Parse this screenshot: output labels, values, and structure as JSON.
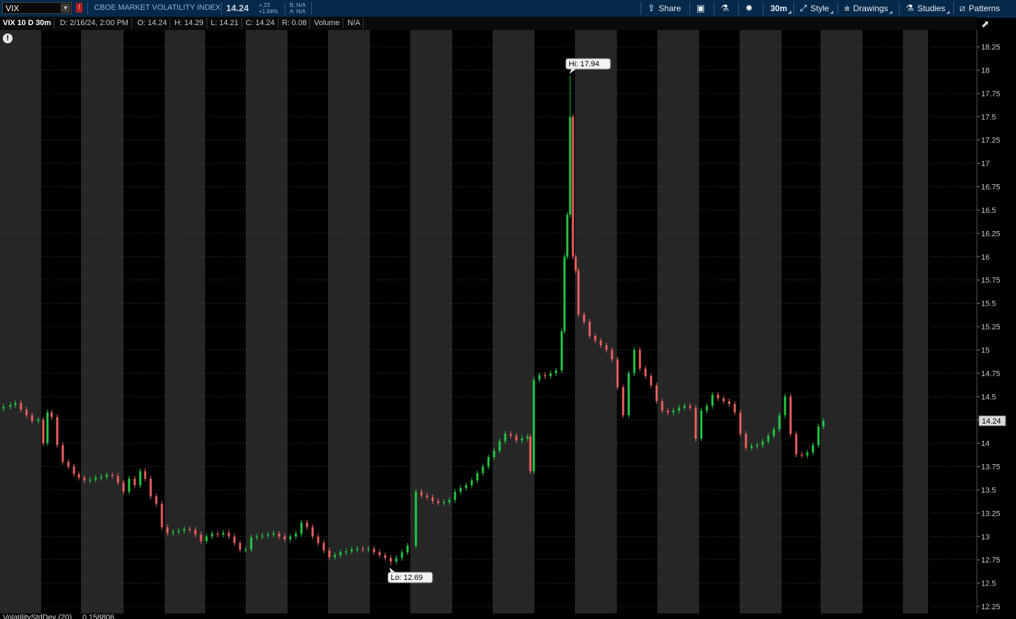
{
  "toolbar": {
    "symbol": "VIX",
    "flag": "!",
    "description": "CBOE MARKET VOLATILITY INDEX",
    "last": "14.24",
    "change": "+.23",
    "change_pct": "+1.64%",
    "bid": "B: N/A",
    "ask": "A: N/A",
    "share": "Share",
    "timeframe": "30m",
    "style": "Style",
    "drawings": "Drawings",
    "studies": "Studies",
    "patterns": "Patterns"
  },
  "infobar": {
    "symbol_period": "VIX 10 D 30m",
    "date": "D: 2/16/24, 2:00 PM",
    "open": "O: 14.24",
    "high": "H: 14.29",
    "low": "L: 14.21",
    "close": "C: 14.24",
    "range": "R: 0.08",
    "volume_label": "Volume",
    "volume_value": "N/A"
  },
  "study": {
    "label": "VolatilityStdDev (20)",
    "value": "0.158806"
  },
  "colors": {
    "up": "#22cc44",
    "down": "#f06060",
    "session_band": "#262626",
    "background": "#000000"
  },
  "chart_data": {
    "type": "candlestick",
    "symbol": "VIX",
    "interval": "30m",
    "y_ticks": [
      "12.25",
      "12.5",
      "12.75",
      "13",
      "13.25",
      "13.5",
      "13.75",
      "14",
      "14.25",
      "14.5",
      "14.75",
      "15",
      "15.25",
      "15.5",
      "15.75",
      "16",
      "16.25",
      "16.5",
      "16.75",
      "17",
      "17.25",
      "17.5",
      "17.75",
      "18",
      "18.25"
    ],
    "ylim": [
      12.2,
      18.4
    ],
    "current_price_label": "14.24",
    "hi_label": "Hi: 17.94",
    "lo_label": "Lo: 12.69",
    "close_path": [
      [
        5,
        14.39
      ],
      [
        15,
        14.41
      ],
      [
        22,
        14.43
      ],
      [
        30,
        14.36
      ],
      [
        38,
        14.3
      ],
      [
        46,
        14.24
      ],
      [
        55,
        14.25
      ],
      [
        62,
        14.0
      ],
      [
        68,
        14.33
      ],
      [
        74,
        14.28
      ],
      [
        82,
        13.98
      ],
      [
        90,
        13.8
      ],
      [
        98,
        13.75
      ],
      [
        106,
        13.67
      ],
      [
        113,
        13.63
      ],
      [
        121,
        13.6
      ],
      [
        129,
        13.61
      ],
      [
        137,
        13.63
      ],
      [
        145,
        13.64
      ],
      [
        153,
        13.66
      ],
      [
        161,
        13.65
      ],
      [
        169,
        13.58
      ],
      [
        177,
        13.48
      ],
      [
        185,
        13.62
      ],
      [
        193,
        13.55
      ],
      [
        201,
        13.7
      ],
      [
        208,
        13.62
      ],
      [
        216,
        13.43
      ],
      [
        224,
        13.35
      ],
      [
        232,
        13.1
      ],
      [
        240,
        13.04
      ],
      [
        248,
        13.05
      ],
      [
        256,
        13.06
      ],
      [
        264,
        13.08
      ],
      [
        272,
        13.07
      ],
      [
        280,
        13.02
      ],
      [
        288,
        12.95
      ],
      [
        296,
        13.0
      ],
      [
        304,
        13.03
      ],
      [
        312,
        13.02
      ],
      [
        320,
        13.04
      ],
      [
        328,
        13.0
      ],
      [
        336,
        12.93
      ],
      [
        344,
        12.86
      ],
      [
        352,
        12.86
      ],
      [
        360,
        12.99
      ],
      [
        368,
        13.0
      ],
      [
        376,
        13.01
      ],
      [
        384,
        13.02
      ],
      [
        392,
        13.03
      ],
      [
        400,
        13.0
      ],
      [
        408,
        12.97
      ],
      [
        416,
        13.0
      ],
      [
        424,
        13.03
      ],
      [
        432,
        13.15
      ],
      [
        440,
        13.1
      ],
      [
        448,
        13.0
      ],
      [
        456,
        12.93
      ],
      [
        464,
        12.85
      ],
      [
        472,
        12.78
      ],
      [
        480,
        12.8
      ],
      [
        488,
        12.83
      ],
      [
        496,
        12.84
      ],
      [
        504,
        12.86
      ],
      [
        512,
        12.87
      ],
      [
        520,
        12.86
      ],
      [
        528,
        12.87
      ],
      [
        536,
        12.83
      ],
      [
        544,
        12.8
      ],
      [
        552,
        12.77
      ],
      [
        560,
        12.73
      ],
      [
        568,
        12.77
      ],
      [
        576,
        12.83
      ],
      [
        584,
        12.9
      ],
      [
        596,
        13.48
      ],
      [
        604,
        13.44
      ],
      [
        612,
        13.42
      ],
      [
        620,
        13.38
      ],
      [
        628,
        13.36
      ],
      [
        636,
        13.37
      ],
      [
        644,
        13.39
      ],
      [
        652,
        13.48
      ],
      [
        660,
        13.52
      ],
      [
        668,
        13.55
      ],
      [
        676,
        13.6
      ],
      [
        684,
        13.68
      ],
      [
        692,
        13.75
      ],
      [
        700,
        13.85
      ],
      [
        708,
        13.92
      ],
      [
        716,
        14.02
      ],
      [
        724,
        14.1
      ],
      [
        732,
        14.08
      ],
      [
        740,
        14.03
      ],
      [
        748,
        14.05
      ],
      [
        756,
        14.07
      ],
      [
        760,
        13.7
      ],
      [
        765,
        14.68
      ],
      [
        773,
        14.73
      ],
      [
        781,
        14.72
      ],
      [
        789,
        14.75
      ],
      [
        797,
        14.78
      ],
      [
        805,
        15.2
      ],
      [
        809,
        16.0
      ],
      [
        813,
        16.45
      ],
      [
        817,
        17.5
      ],
      [
        821,
        16.0
      ],
      [
        825,
        15.85
      ],
      [
        829,
        15.38
      ],
      [
        837,
        15.3
      ],
      [
        845,
        15.15
      ],
      [
        853,
        15.1
      ],
      [
        861,
        15.05
      ],
      [
        869,
        15.0
      ],
      [
        877,
        14.9
      ],
      [
        885,
        14.6
      ],
      [
        893,
        14.3
      ],
      [
        901,
        14.75
      ],
      [
        909,
        15.0
      ],
      [
        917,
        14.8
      ],
      [
        925,
        14.72
      ],
      [
        933,
        14.62
      ],
      [
        941,
        14.45
      ],
      [
        949,
        14.35
      ],
      [
        957,
        14.33
      ],
      [
        965,
        14.35
      ],
      [
        973,
        14.38
      ],
      [
        981,
        14.4
      ],
      [
        989,
        14.38
      ],
      [
        997,
        14.05
      ],
      [
        1005,
        14.35
      ],
      [
        1013,
        14.4
      ],
      [
        1021,
        14.52
      ],
      [
        1029,
        14.48
      ],
      [
        1037,
        14.45
      ],
      [
        1045,
        14.42
      ],
      [
        1053,
        14.33
      ],
      [
        1061,
        14.1
      ],
      [
        1069,
        13.95
      ],
      [
        1077,
        13.97
      ],
      [
        1085,
        13.98
      ],
      [
        1093,
        14.02
      ],
      [
        1101,
        14.08
      ],
      [
        1109,
        14.15
      ],
      [
        1117,
        14.3
      ],
      [
        1125,
        14.5
      ],
      [
        1133,
        14.1
      ],
      [
        1141,
        13.88
      ],
      [
        1149,
        13.87
      ],
      [
        1157,
        13.9
      ],
      [
        1165,
        13.98
      ],
      [
        1173,
        14.18
      ],
      [
        1180,
        14.24
      ]
    ]
  }
}
